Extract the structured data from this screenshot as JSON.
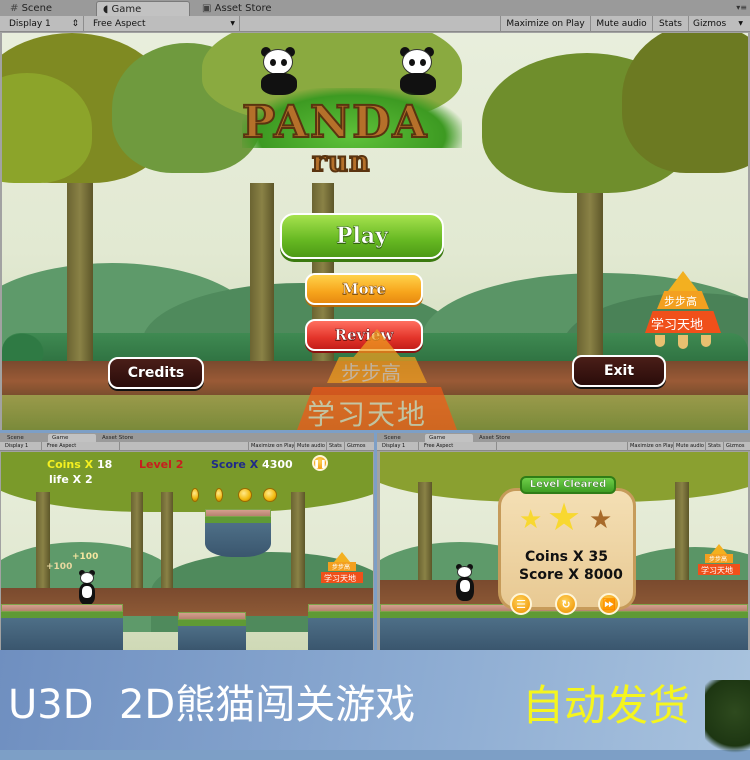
{
  "unity_editor": {
    "tabs": [
      {
        "label": "Scene",
        "icon": "grid-icon",
        "active": false
      },
      {
        "label": "Game",
        "icon": "pacman-icon",
        "active": true
      },
      {
        "label": "Asset Store",
        "icon": "store-bag-icon",
        "active": false
      }
    ],
    "toolbar": {
      "display": "Display 1",
      "aspect": "Free Aspect",
      "maximize_on_play": "Maximize on Play",
      "mute_audio": "Mute audio",
      "stats": "Stats",
      "gizmos": "Gizmos"
    }
  },
  "main_menu": {
    "logo_line1": "PANDA",
    "logo_line2": "run",
    "buttons": {
      "play": "Play",
      "more": "More",
      "review": "Review",
      "credits": "Credits",
      "exit": "Exit"
    },
    "watermark": {
      "line1": "步步高",
      "line2": "学习天地"
    }
  },
  "gameplay": {
    "hud": {
      "coins_label": "Coins X",
      "coins_value": "18",
      "life_label": "life X",
      "life_value": "2",
      "level": "Level 2",
      "score_label": "Score X",
      "score_value": "4300",
      "pause_icon": "pause-icon"
    },
    "floating_points": [
      "+100",
      "+100"
    ],
    "watermark": {
      "line1": "步步高",
      "line2": "学习天地"
    }
  },
  "level_cleared": {
    "ribbon": "Level Cleared",
    "stars_earned": 2,
    "stars_total": 3,
    "coins_label": "Coins X",
    "coins_value": "35",
    "score_label": "Score X",
    "score_value": "8000",
    "buttons": [
      {
        "icon": "menu-list-icon",
        "name": "menu"
      },
      {
        "icon": "restart-icon",
        "name": "restart"
      },
      {
        "icon": "next-icon",
        "name": "next"
      }
    ],
    "watermark": {
      "line1": "步步高",
      "line2": "学习天地"
    }
  },
  "banner": {
    "title": "U3D  2D熊猫闯关游戏",
    "highlight": "自动发货",
    "title_color": "#ffffff",
    "highlight_color": "#f5f51e"
  }
}
